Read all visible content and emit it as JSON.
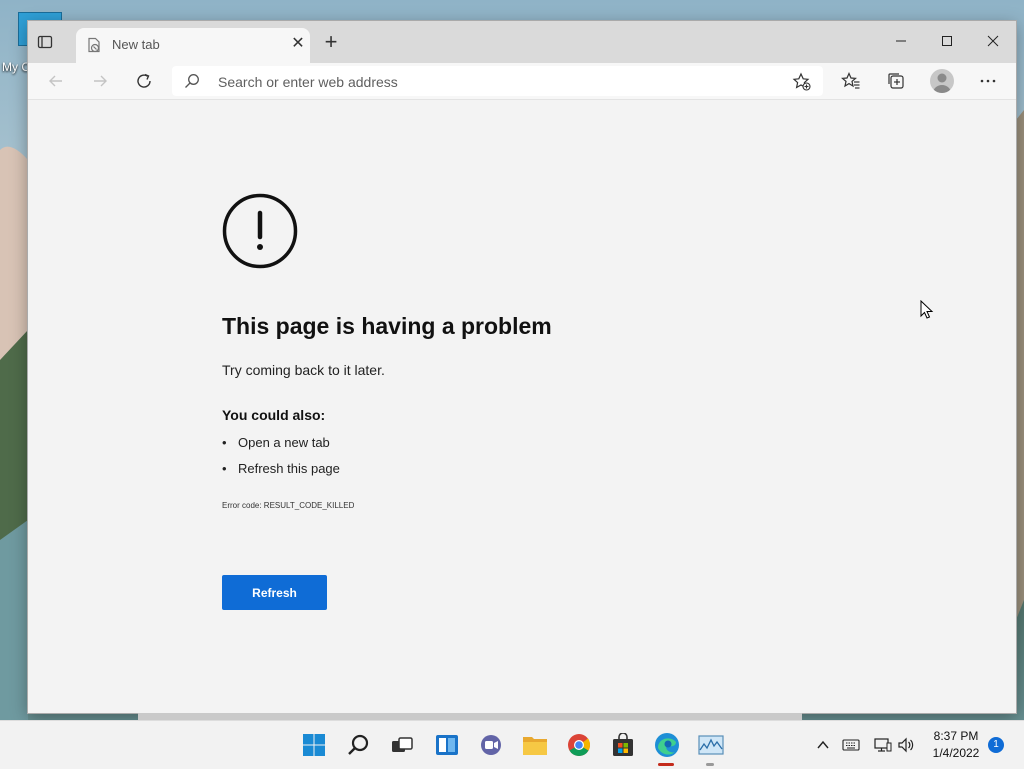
{
  "desktop": {
    "icon_label": "My C"
  },
  "browser": {
    "tab": {
      "title": "New tab"
    },
    "address": {
      "placeholder": "Search or enter web address"
    }
  },
  "error_page": {
    "title": "This page is having a problem",
    "subtitle": "Try coming back to it later.",
    "also_heading": "You could also:",
    "suggestions": [
      "Open a new tab",
      "Refresh this page"
    ],
    "error_code": "Error code: RESULT_CODE_KILLED",
    "refresh_label": "Refresh"
  },
  "taskbar": {
    "apps": [
      "start",
      "search",
      "task-view",
      "widgets",
      "chat",
      "file-explorer",
      "chrome",
      "store",
      "edge",
      "resource-monitor"
    ],
    "time": "8:37 PM",
    "date": "1/4/2022",
    "notifications": "1"
  },
  "colors": {
    "accent": "#0f6cd6",
    "window_bg": "#f3f3f3",
    "tabbar_bg": "#dadada"
  }
}
